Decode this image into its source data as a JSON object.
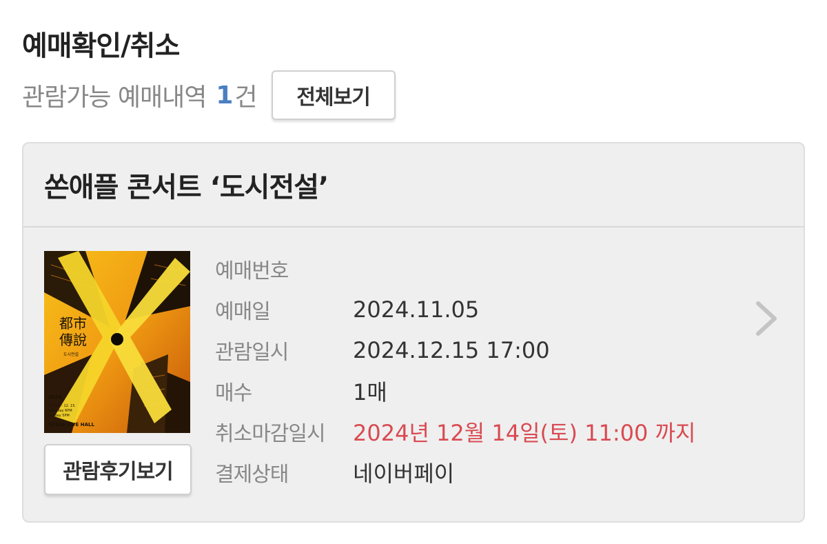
{
  "page": {
    "title": "예매확인/취소"
  },
  "summary": {
    "text": "관람가능 예매내역",
    "count": "1",
    "unit": "건",
    "view_all_label": "전체보기"
  },
  "booking": {
    "event_title": "쏜애플 콘서트 ‘도시전설’",
    "review_button_label": "관람후기보기",
    "poster": {
      "chinese_title_line1": "都市",
      "chinese_title_line2": "傳說",
      "korean_subtitle": "도시전설",
      "year": "2024",
      "dates": "12. 14. - 12. 15.",
      "time_sat": "Saturday 6PM",
      "time_sun": "Sunday 5PM",
      "venue": "YES24 LIVE HALL"
    },
    "fields": [
      {
        "label": "예매번호",
        "value": ""
      },
      {
        "label": "예매일",
        "value": "2024.11.05"
      },
      {
        "label": "관람일시",
        "value": "2024.12.15 17:00"
      },
      {
        "label": "매수",
        "value": "1매"
      },
      {
        "label": "취소마감일시",
        "value": "2024년 12월 14일(토) 11:00 까지"
      },
      {
        "label": "결제상태",
        "value": "네이버페이"
      }
    ]
  },
  "colors": {
    "accent_blue": "#4a7fc1",
    "warn_red": "#d94a52",
    "card_bg": "#efefef"
  }
}
